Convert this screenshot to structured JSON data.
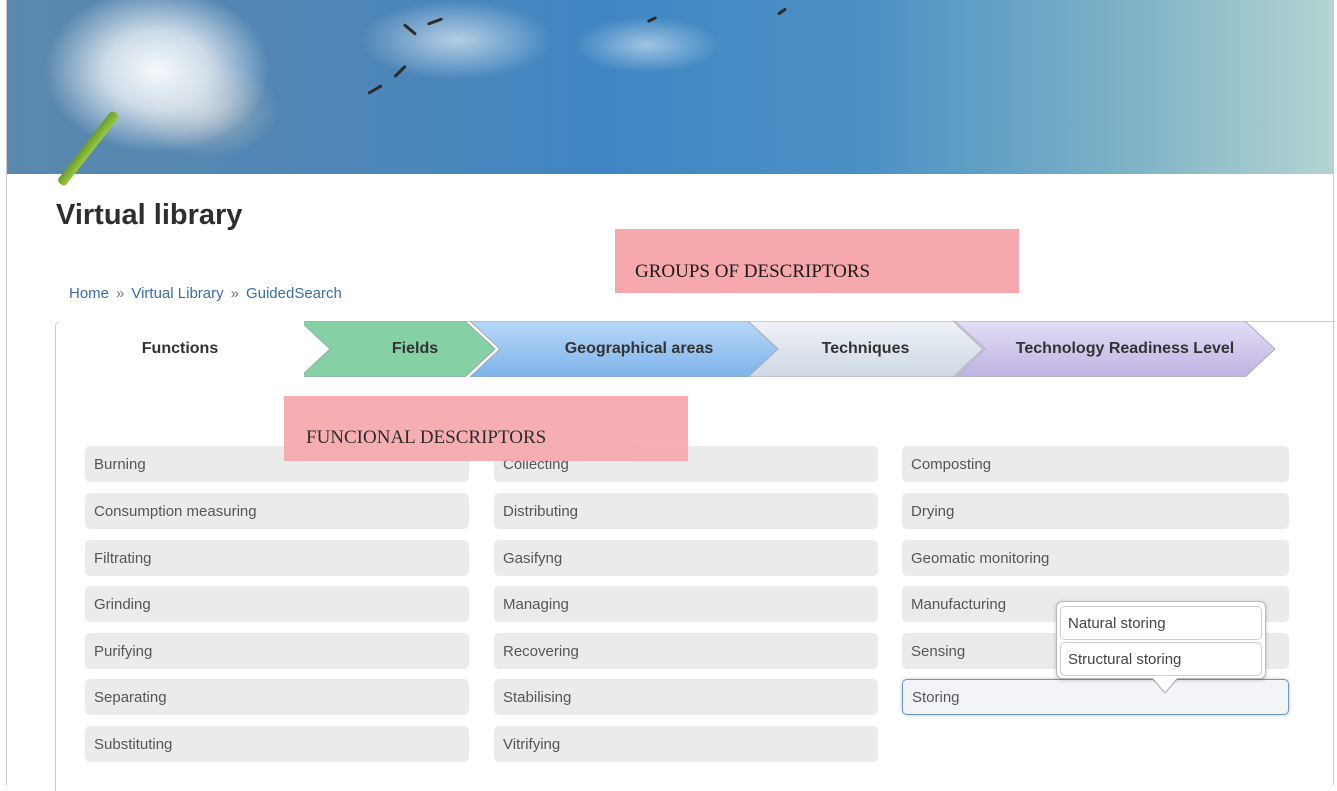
{
  "page": {
    "title": "Virtual library"
  },
  "breadcrumb": {
    "home": "Home",
    "sep": "»",
    "library": "Virtual Library",
    "current": "GuidedSearch"
  },
  "annotations": {
    "groups": "GROUPS OF DESCRIPTORS",
    "functional": "FUNCIONAL DESCRIPTORS"
  },
  "tabs": [
    {
      "label": "Functions",
      "color": "#ffffff"
    },
    {
      "label": "Fields",
      "color": "#86d0a6"
    },
    {
      "label": "Geographical areas",
      "color": "#8fc0f0"
    },
    {
      "label": "Techniques",
      "color": "#d7dee8"
    },
    {
      "label": "Technology Readiness Level",
      "color": "#c7bde6"
    }
  ],
  "descriptors": {
    "col1": [
      "Burning",
      "Consumption measuring",
      "Filtrating",
      "Grinding",
      "Purifying",
      "Separating",
      "Substituting"
    ],
    "col2": [
      "Collecting",
      "Distributing",
      "Gasifyng",
      "Managing",
      "Recovering",
      "Stabilising",
      "Vitrifying"
    ],
    "col3": [
      "Composting",
      "Drying",
      "Geomatic monitoring",
      "Manufacturing",
      "Sensing",
      "Storing"
    ]
  },
  "popup": {
    "options": [
      "Natural storing",
      "Structural storing"
    ]
  }
}
